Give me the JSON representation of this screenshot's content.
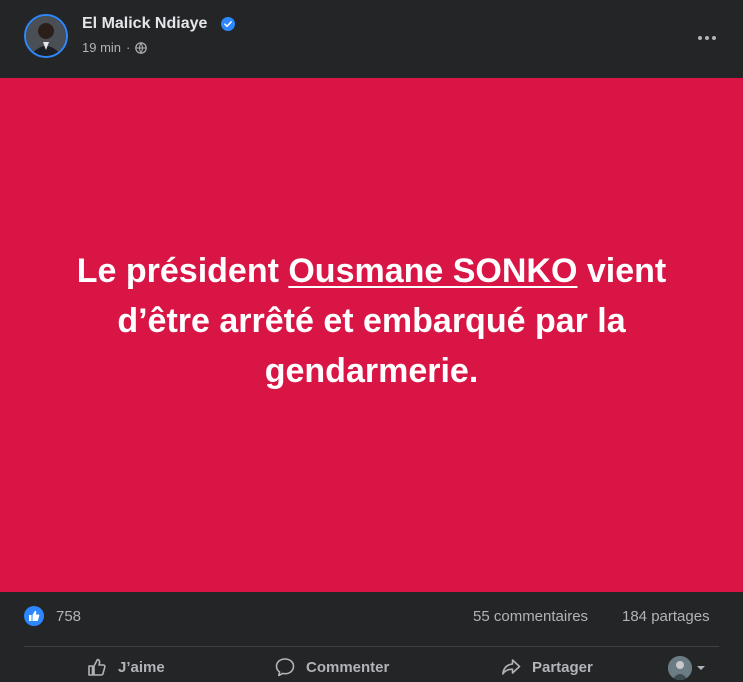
{
  "post": {
    "author": "El Malick Ndiaye",
    "time": "19 min",
    "dot": "·",
    "banner": {
      "line_prefix": "Le président ",
      "link_text": "Ousmane SONKO",
      "line_suffix": " vient d’être arrêté et embarqué par la gendarmerie."
    },
    "reactions_count": "758",
    "comments_count": "55 commentaires",
    "shares_count": "184 partages"
  },
  "actions": {
    "like_label": "J’aime",
    "comment_label": "Commenter",
    "share_label": "Partager"
  },
  "colors": {
    "banner_bg": "#d91545",
    "page_bg": "#242526",
    "accent_blue": "#2d88ff"
  },
  "icons": [
    "verified-badge-icon",
    "globe-icon",
    "more-options-icon",
    "like-reaction-icon",
    "thumbs-up-icon",
    "comment-icon",
    "share-icon",
    "chevron-down-icon"
  ]
}
